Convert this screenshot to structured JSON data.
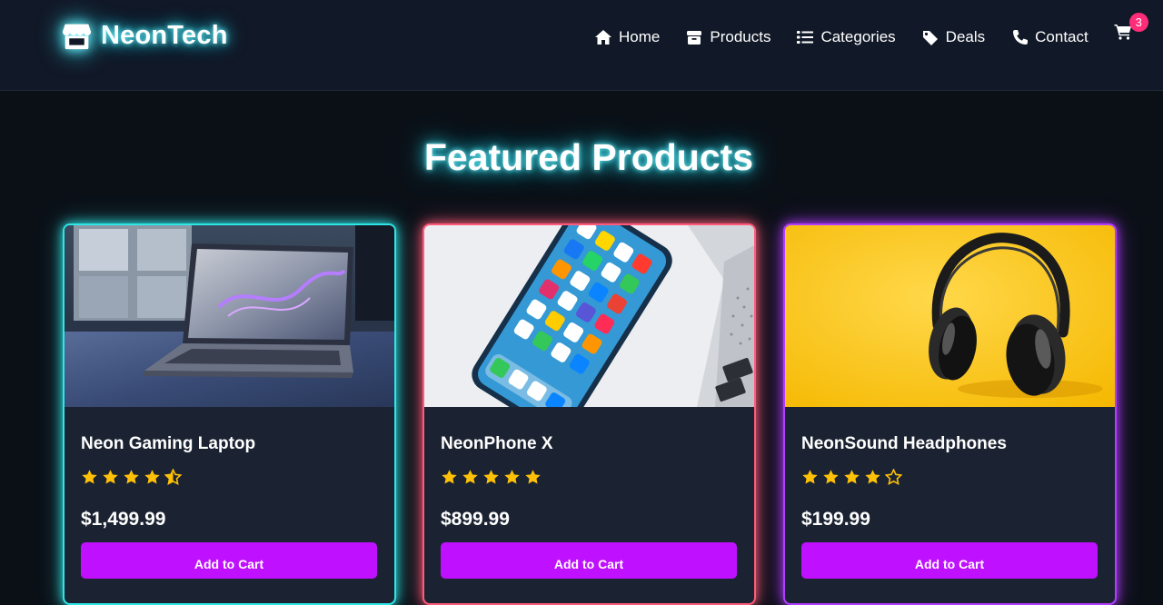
{
  "brand": {
    "name": "NeonTech",
    "icon": "store-icon",
    "glow_color": "#2ad6e6"
  },
  "nav": {
    "items": [
      {
        "label": "Home",
        "icon": "home-icon"
      },
      {
        "label": "Products",
        "icon": "box-icon"
      },
      {
        "label": "Categories",
        "icon": "list-icon"
      },
      {
        "label": "Deals",
        "icon": "tag-icon"
      },
      {
        "label": "Contact",
        "icon": "phone-icon"
      }
    ],
    "cart": {
      "icon": "cart-icon",
      "count": "3",
      "badge_color": "#ff2d78"
    }
  },
  "section": {
    "title": "Featured Products"
  },
  "products": [
    {
      "name": "Neon Gaming Laptop",
      "rating": 4.5,
      "price": "$1,499.99",
      "button": "Add to Cart",
      "accent": "#2ee6e6",
      "image": "laptop-photo"
    },
    {
      "name": "NeonPhone X",
      "rating": 5,
      "price": "$899.99",
      "button": "Add to Cart",
      "accent": "#ff5a7a",
      "image": "smartphone-photo"
    },
    {
      "name": "NeonSound Headphones",
      "rating": 4,
      "price": "$199.99",
      "button": "Add to Cart",
      "accent": "#b23cff",
      "image": "headphones-photo"
    }
  ],
  "colors": {
    "background": "#0b1017",
    "header": "#111827",
    "card": "#1b2332",
    "button": "#bf10ff",
    "star": "#ffc107"
  }
}
